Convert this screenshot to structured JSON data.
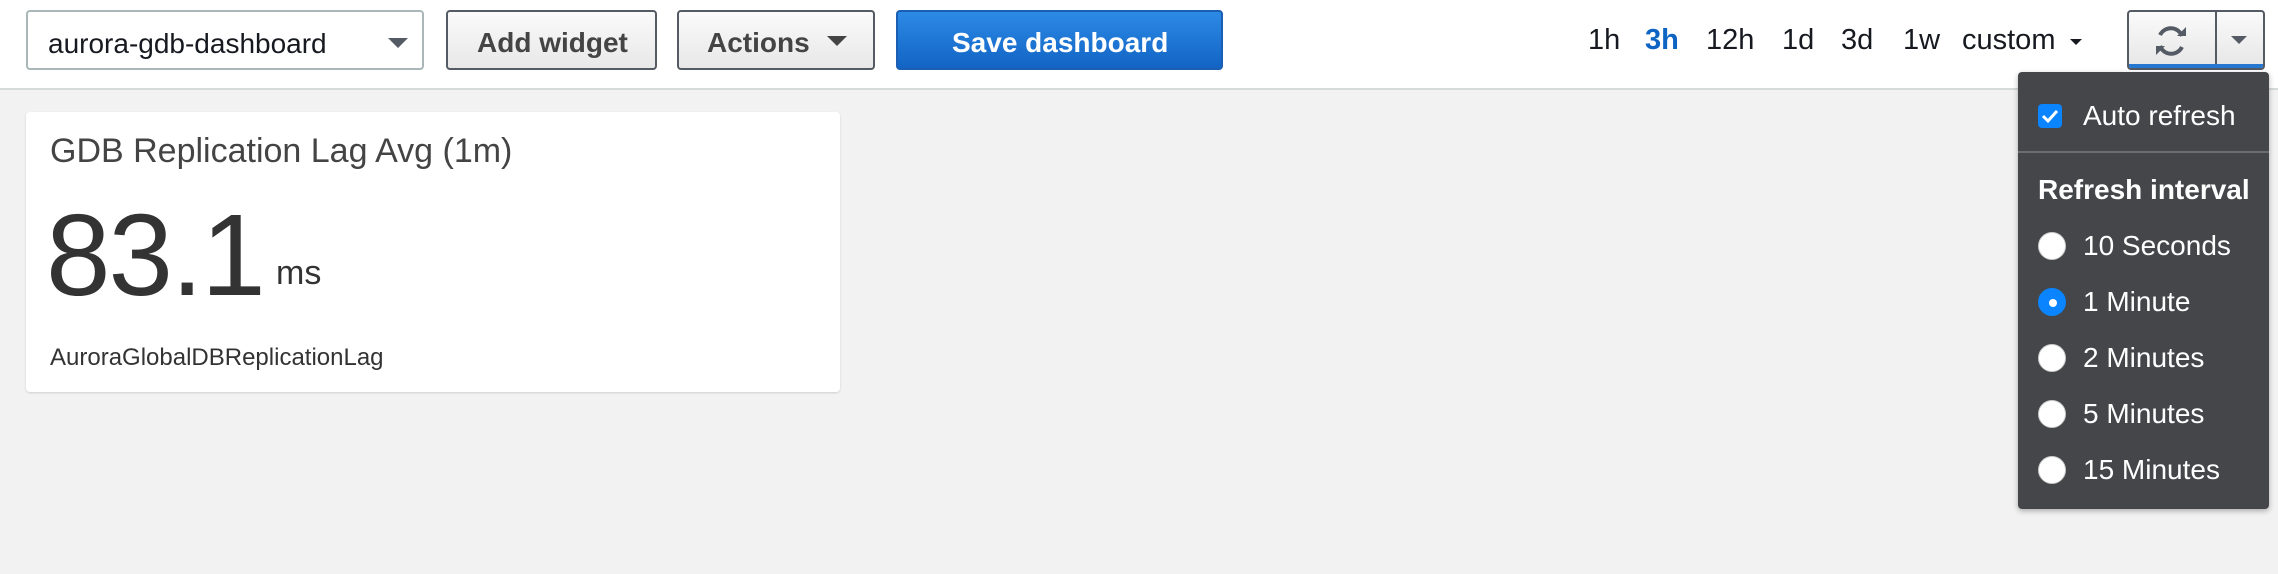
{
  "toolbar": {
    "dashboard_select": {
      "value": "aurora-gdb-dashboard",
      "icon": "chevron-down-icon"
    },
    "add_widget_label": "Add widget",
    "actions_label": "Actions",
    "save_label": "Save dashboard",
    "time_ranges": [
      "1h",
      "3h",
      "12h",
      "1d",
      "3d",
      "1w"
    ],
    "active_range": "3h",
    "custom_label": "custom",
    "refresh_icon": "refresh-icon"
  },
  "widget": {
    "title": "GDB Replication Lag Avg (1m)",
    "value": "83.1",
    "unit": "ms",
    "metric_name": "AuroraGlobalDBReplicationLag"
  },
  "refresh_menu": {
    "auto_refresh_label": "Auto refresh",
    "auto_refresh_checked": true,
    "interval_header": "Refresh interval",
    "options": [
      {
        "label": "10 Seconds",
        "selected": false
      },
      {
        "label": "1 Minute",
        "selected": true
      },
      {
        "label": "2 Minutes",
        "selected": false
      },
      {
        "label": "5 Minutes",
        "selected": false
      },
      {
        "label": "15 Minutes",
        "selected": false
      }
    ]
  },
  "colors": {
    "primary": "#1264c4",
    "active_link": "#0d64c2",
    "menu_bg": "#444649",
    "control_blue": "#0a84ff"
  }
}
